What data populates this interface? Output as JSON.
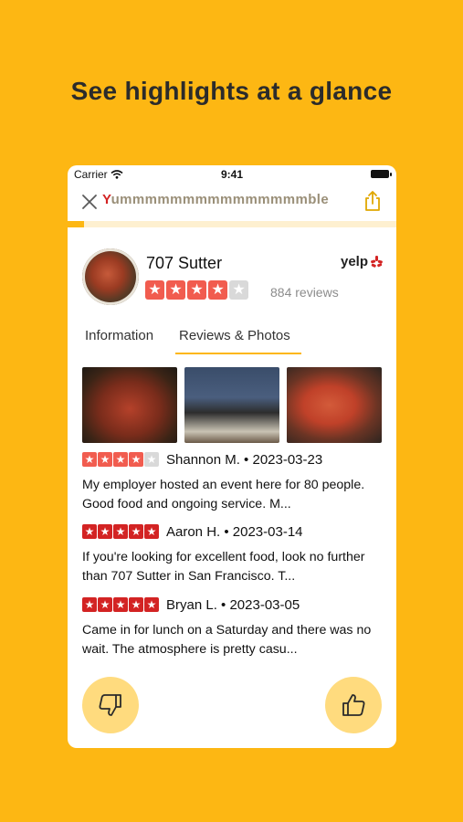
{
  "headline": "See highlights at a glance",
  "status_bar": {
    "carrier": "Carrier",
    "time": "9:41"
  },
  "app": {
    "title_first_letter": "Y",
    "title_rest": "ummmmmmmmmmmmmmmble",
    "progress_fraction": 0.05
  },
  "business": {
    "name": "707 Sutter",
    "rating_stars": 4,
    "rating_max": 5,
    "review_count_text": "884 reviews",
    "source_logo": "yelp"
  },
  "tabs": [
    {
      "label": "Information",
      "active": false
    },
    {
      "label": "Reviews & Photos",
      "active": true
    }
  ],
  "reviews": [
    {
      "stars": 4,
      "author_date": "Shannon M. • 2023-03-23",
      "text": "My employer hosted an event here for 80 people. Good food and ongoing service. M..."
    },
    {
      "stars": 5,
      "author_date": "Aaron H. • 2023-03-14",
      "text": "If you're looking for excellent food, look no further than 707 Sutter in San Francisco. T..."
    },
    {
      "stars": 5,
      "author_date": "Bryan L. • 2023-03-05",
      "text": "Came in for lunch on a Saturday and there was no wait. The atmosphere is pretty casu..."
    }
  ],
  "colors": {
    "background": "#FDB713",
    "star_orange": "#F15C4F",
    "star_red": "#D32323",
    "button_bg": "#FFDB7E"
  },
  "icons": {
    "close": "close-icon",
    "share": "share-icon",
    "thumbs_down": "thumbs-down-icon",
    "thumbs_up": "thumbs-up-icon"
  }
}
